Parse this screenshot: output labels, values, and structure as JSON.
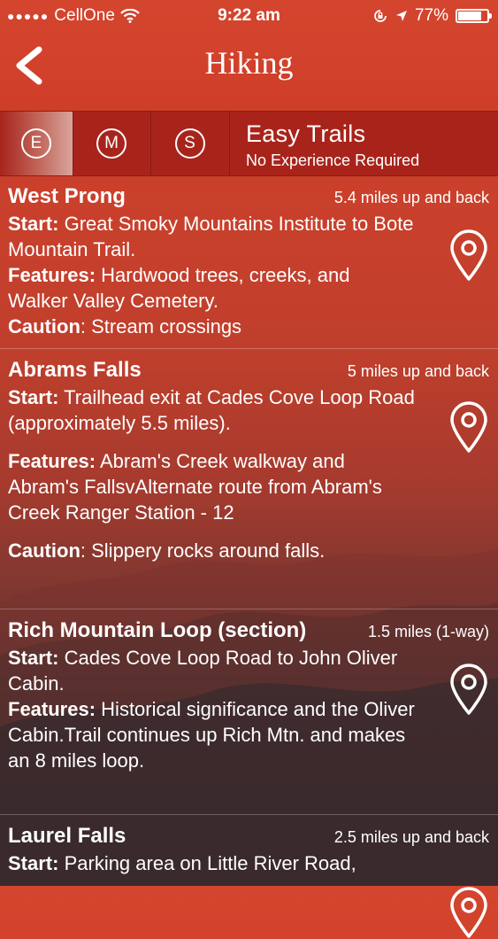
{
  "status": {
    "carrier": "CellOne",
    "time": "9:22 am",
    "battery": "77%",
    "battery_fraction": 0.77
  },
  "nav": {
    "title": "Hiking",
    "back_icon": "chevron-left-icon"
  },
  "segments": [
    {
      "letter": "E",
      "active": true
    },
    {
      "letter": "M",
      "active": false
    },
    {
      "letter": "S",
      "active": false
    }
  ],
  "category": {
    "title": "Easy Trails",
    "subtitle": "No Experience Required"
  },
  "trails": [
    {
      "name": "West Prong",
      "distance": "5.4 miles up and back",
      "start_label": "Start:",
      "start": "Great Smoky Mountains Institute to Bote Mountain Trail.",
      "features_label": "Features:",
      "features": "Hardwood trees, creeks, and Walker Valley Cemetery.",
      "caution_label": "Caution",
      "caution": ": Stream crossings"
    },
    {
      "name": "Abrams Falls",
      "distance": "5 miles up and back",
      "start_label": "Start:",
      "start": "Trailhead exit at Cades Cove Loop Road (approximately 5.5 miles).",
      "features_label": "Features:",
      "features": "Abram's Creek walkway and Abram's FallsvAlternate route from Abram's Creek Ranger Station - 12",
      "caution_label": "Caution",
      "caution": ": Slippery rocks around falls."
    },
    {
      "name": "Rich Mountain Loop (section)",
      "distance": "1.5 miles (1-way)",
      "start_label": "Start:",
      "start": "Cades Cove Loop Road to John Oliver Cabin.",
      "features_label": "Features:",
      "features": "Historical significance and the Oliver Cabin.Trail continues up Rich Mtn. and makes an 8 miles loop."
    },
    {
      "name": "Laurel Falls",
      "distance": "2.5 miles up and back",
      "start_label": "Start:",
      "start": "Parking area on Little River Road,"
    }
  ]
}
